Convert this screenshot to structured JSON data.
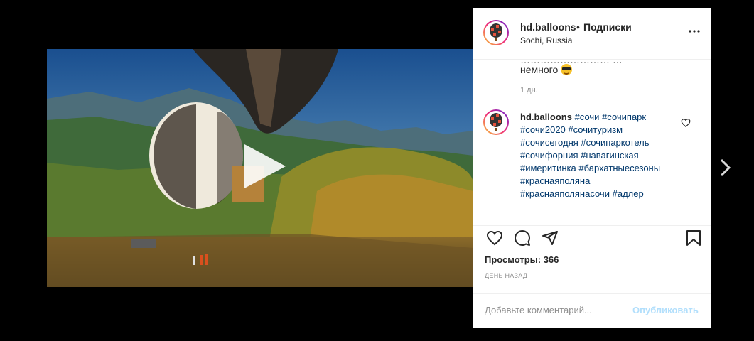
{
  "post": {
    "username": "hd.balloons",
    "separator": "•",
    "follow_label": "Подписки",
    "location": "Sochi, Russia"
  },
  "previous_comment": {
    "text_partial": "……………………… …",
    "text": "немного",
    "emoji": "smiling-face-with-sunglasses",
    "time": "1 дн."
  },
  "caption": {
    "username": "hd.balloons",
    "hashtags": [
      "#сочи",
      "#сочипарк",
      "#сочи2020",
      "#сочитуризм",
      "#сочисегодня",
      "#сочипаркотель",
      "#сочифорния",
      "#навагинская",
      "#имеритинка",
      "#бархатныесезоны",
      "#краснаяполяна",
      "#краснаяполянасочи",
      "#адлер"
    ]
  },
  "stats": {
    "views_label": "Просмотры: 366",
    "date_label": "ДЕНЬ НАЗАД"
  },
  "comment_box": {
    "placeholder": "Добавьте комментарий...",
    "post_label": "Опубликовать"
  },
  "colors": {
    "link": "#00376b",
    "post_disabled": "#b2dffc",
    "muted": "#8e8e8e"
  }
}
